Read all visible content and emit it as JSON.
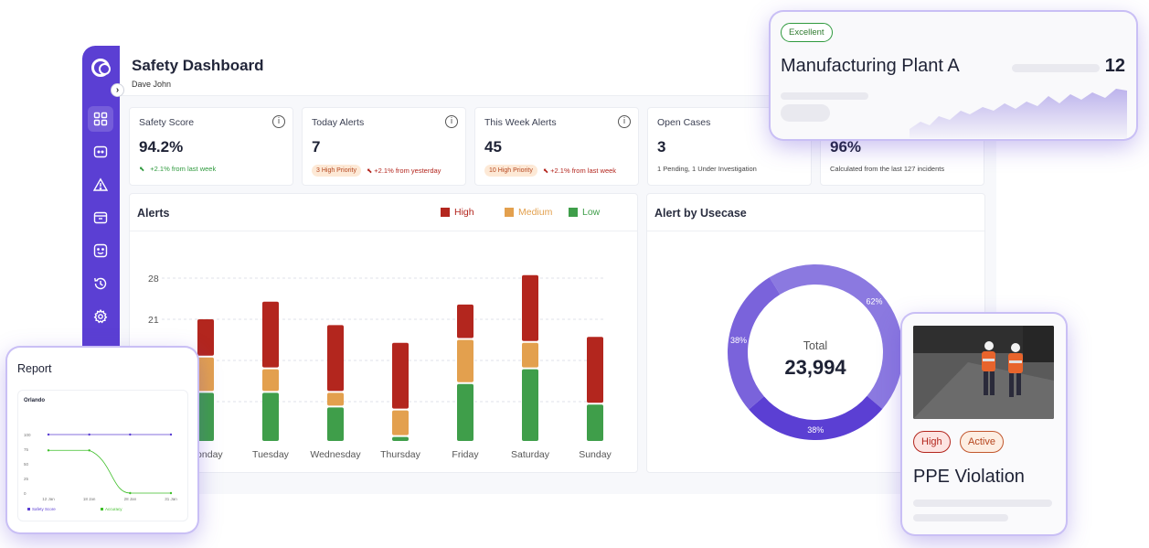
{
  "header": {
    "title": "Safety Dashboard",
    "user": "Dave John"
  },
  "kpis": [
    {
      "label": "Safety Score",
      "value": "94.2%",
      "trend": "+2.1% from last week",
      "trend_color": "#2f9a3e"
    },
    {
      "label": "Today Alerts",
      "value": "7",
      "pill": "3 High Priority",
      "trend": "+2.1% from yesterday",
      "trend_color": "#b3261e"
    },
    {
      "label": "This Week Alerts",
      "value": "45",
      "pill": "10 High Priority",
      "trend": "+2.1% from last week",
      "trend_color": "#b3261e"
    },
    {
      "label": "Open Cases",
      "value": "3",
      "note": "1 Pending, 1 Under Investigation"
    },
    {
      "value": "96%",
      "note": "Calculated from the last 127 incidents"
    }
  ],
  "alerts_panel": {
    "title": "Alerts",
    "legend": [
      {
        "label": "High",
        "color": "#b3261e"
      },
      {
        "label": "Medium",
        "color": "#e3a04e"
      },
      {
        "label": "Low",
        "color": "#3f9e4a"
      }
    ]
  },
  "chart_data": {
    "type": "bar",
    "stacked": true,
    "categories": [
      "Monday",
      "Tuesday",
      "Wednesday",
      "Thursday",
      "Friday",
      "Saturday",
      "Sunday"
    ],
    "series": [
      {
        "name": "Low",
        "values": [
          8.5,
          8.5,
          6,
          1,
          10,
          12.5,
          6.5
        ]
      },
      {
        "name": "Medium",
        "values": [
          6,
          4,
          2.5,
          4.5,
          7.5,
          4.5,
          0
        ]
      },
      {
        "name": "High",
        "values": [
          6.5,
          11.5,
          11.5,
          11.5,
          6,
          11.5,
          11.5
        ]
      }
    ],
    "y_ticks": [
      21,
      28
    ],
    "ylim": [
      0,
      28
    ],
    "grid": true
  },
  "usecase_panel": {
    "title": "Alert by Usecase",
    "total_label": "Total",
    "total_value": "23,994",
    "slices": [
      {
        "label": "62%",
        "value": 62,
        "color": "#8b79e0"
      },
      {
        "label": "38%",
        "value": 38,
        "color": "#5b3fd3"
      },
      {
        "label": "38%",
        "value": 38,
        "color": "#7a63db"
      }
    ]
  },
  "plant_card": {
    "badge": "Excellent",
    "name": "Manufacturing Plant A",
    "count": "12"
  },
  "report_card": {
    "title": "Report",
    "subtitle": "Orlando",
    "y_ticks": [
      "100",
      "75",
      "50",
      "25",
      "0"
    ],
    "x_ticks": [
      "12 Jan",
      "18 Jan",
      "28 Jan",
      "31 Jan"
    ],
    "series": [
      {
        "name": "Safety Score",
        "values": [
          100,
          100,
          100,
          100
        ],
        "color": "#5b3fd3"
      },
      {
        "name": "Accuracy",
        "values": [
          73,
          73,
          0,
          0
        ],
        "color": "#3fbf2a"
      }
    ]
  },
  "ppe_card": {
    "tags": [
      "High",
      "Active"
    ],
    "title": "PPE Violation"
  }
}
